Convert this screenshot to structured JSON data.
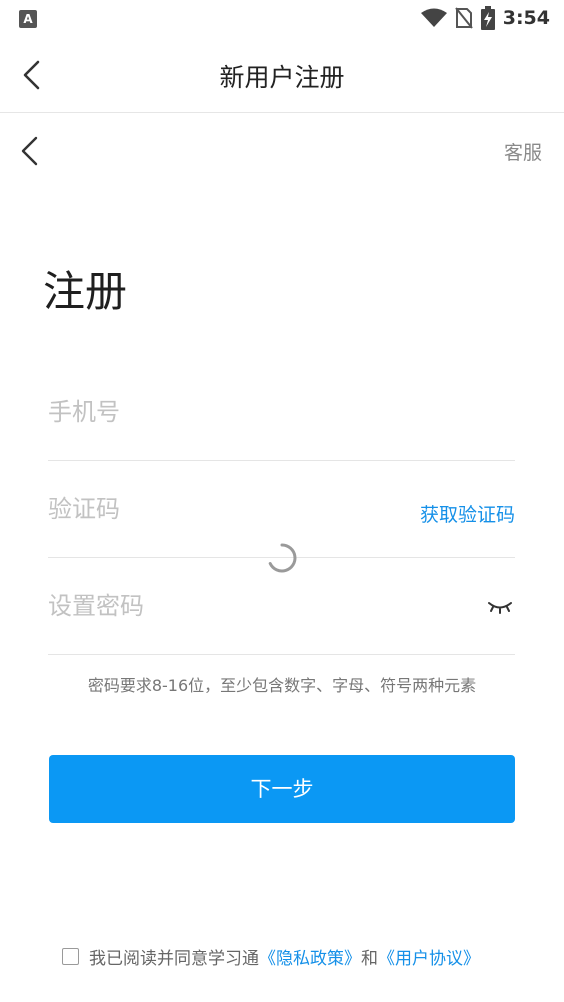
{
  "status_bar": {
    "app_badge": "A",
    "time": "3:54"
  },
  "appbar": {
    "title": "新用户注册"
  },
  "page": {
    "service_label": "客服",
    "heading": "注册",
    "phone_placeholder": "手机号",
    "code_placeholder": "验证码",
    "get_code_label": "获取验证码",
    "password_placeholder": "设置密码",
    "password_hint": "密码要求8-16位，至少包含数字、字母、符号两种元素",
    "next_label": "下一步"
  },
  "agreement": {
    "prefix": "我已阅读并同意学习通",
    "privacy_label": "《隐私政策》",
    "conjunction": "和",
    "terms_label": "《用户协议》"
  },
  "colors": {
    "accent": "#0b98f4",
    "link": "#1590e8"
  },
  "icons": [
    "wifi-icon",
    "no-sim-icon",
    "battery-charging-icon",
    "back-arrow-icon",
    "eye-closed-icon",
    "loading-spinner-icon"
  ]
}
